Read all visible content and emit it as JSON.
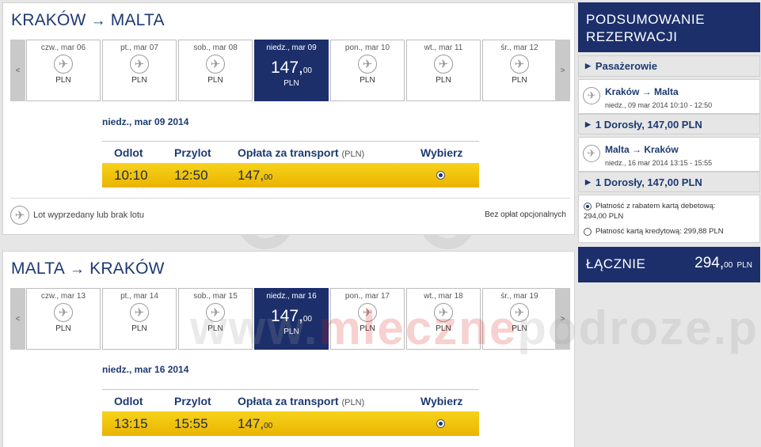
{
  "outbound": {
    "title_from": "KRAKÓW",
    "title_arrow": "→",
    "title_to": "MALTA",
    "days": [
      {
        "label": "czw., mar 06",
        "currency": "PLN"
      },
      {
        "label": "pt., mar 07",
        "currency": "PLN"
      },
      {
        "label": "sob., mar 08",
        "currency": "PLN"
      },
      {
        "label": "niedz., mar 09",
        "price_main": "147,",
        "price_dec": "00",
        "currency": "PLN"
      },
      {
        "label": "pon., mar 10",
        "currency": "PLN"
      },
      {
        "label": "wt., mar 11",
        "currency": "PLN"
      },
      {
        "label": "śr., mar 12",
        "currency": "PLN"
      }
    ],
    "selected_date": "niedz., mar 09 2014",
    "headers": {
      "departure": "Odlot",
      "arrival": "Przylot",
      "fare": "Opłata za transport",
      "fare_unit": "(PLN)",
      "select": "Wybierz"
    },
    "flight": {
      "departure": "10:10",
      "arrival": "12:50",
      "price_main": "147,",
      "price_dec": "00"
    },
    "legend": "Lot wyprzedany lub brak lotu",
    "fees_note": "Bez opłat opcjonalnych"
  },
  "return": {
    "title_from": "MALTA",
    "title_arrow": "→",
    "title_to": "KRAKÓW",
    "days": [
      {
        "label": "czw., mar 13",
        "currency": "PLN"
      },
      {
        "label": "pt., mar 14",
        "currency": "PLN"
      },
      {
        "label": "sob., mar 15",
        "currency": "PLN"
      },
      {
        "label": "niedz., mar 16",
        "price_main": "147,",
        "price_dec": "00",
        "currency": "PLN"
      },
      {
        "label": "pon., mar 17",
        "currency": "PLN"
      },
      {
        "label": "wt., mar 18",
        "currency": "PLN"
      },
      {
        "label": "śr., mar 19",
        "currency": "PLN"
      }
    ],
    "selected_date": "niedz., mar 16 2014",
    "headers": {
      "departure": "Odlot",
      "arrival": "Przylot",
      "fare": "Opłata za transport",
      "fare_unit": "(PLN)",
      "select": "Wybierz"
    },
    "flight": {
      "departure": "13:15",
      "arrival": "15:55",
      "price_main": "147,",
      "price_dec": "00"
    }
  },
  "nav": {
    "prev": "<",
    "next": ">"
  },
  "summary": {
    "title_line1": "PODSUMOWANIE",
    "title_line2": "REZERWACJI",
    "passengers": "Pasażerowie",
    "leg1": {
      "route": "Kraków → Malta",
      "time": "niedz., 09 mar 2014 10:10 - 12:50",
      "adults": "1 Dorosły, 147,00 PLN"
    },
    "leg2": {
      "route": "Malta → Kraków",
      "time": "niedz., 16 mar 2014 13:15 - 15:55",
      "adults": "1 Dorosły, 147,00 PLN"
    },
    "payment_debit": "Płatność z rabatem kartą debetową:",
    "payment_debit_amount": "294,00 PLN",
    "payment_credit": "Płatność kartą kredytową: 299,88 PLN",
    "total_label": "ŁĄCZNIE",
    "total_main": "294,",
    "total_dec": "00",
    "total_cur": "PLN"
  },
  "watermark": {
    "part1": "www.",
    "part2": "mleczne",
    "part3": "podroze.pl"
  },
  "icons": {
    "plane": "plane-icon",
    "triangle": "triangle-right-icon"
  },
  "colors": {
    "brand_navy": "#1c2f6b",
    "fare_yellow": "#f2c40c",
    "panel_bg": "#ffffff",
    "page_bg": "#e6e6e6"
  }
}
